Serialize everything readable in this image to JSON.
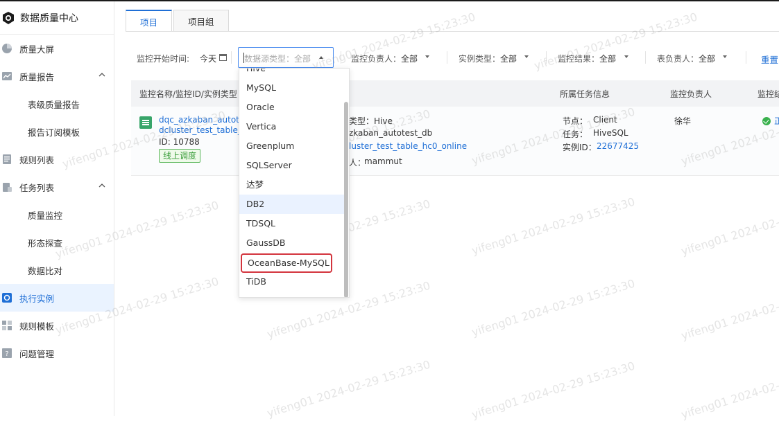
{
  "sidebar": {
    "brand": "数据质量中心",
    "items": [
      {
        "label": "质量大屏",
        "icon": "pie-chart-icon"
      },
      {
        "label": "质量报告",
        "icon": "report-icon"
      },
      {
        "label": "表级质量报告"
      },
      {
        "label": "报告订阅模板"
      },
      {
        "label": "规则列表",
        "icon": "list-icon"
      },
      {
        "label": "任务列表",
        "icon": "task-icon"
      },
      {
        "label": "质量监控"
      },
      {
        "label": "形态探查"
      },
      {
        "label": "数据比对"
      },
      {
        "label": "执行实例",
        "icon": "instance-icon",
        "active": true
      },
      {
        "label": "规则模板",
        "icon": "template-icon"
      },
      {
        "label": "问题管理",
        "icon": "question-icon"
      }
    ]
  },
  "tabs": [
    {
      "label": "项目",
      "active": true
    },
    {
      "label": "项目组",
      "active": false
    }
  ],
  "filters": {
    "start_time_label": "监控开始时间:",
    "start_time_value": "今天",
    "datasource_placeholder": "数据源类型：全部",
    "owner_label": "监控负责人：",
    "owner_value": "全部",
    "instance_type_label": "实例类型：",
    "instance_type_value": "全部",
    "result_label": "监控结果：",
    "result_value": "全部",
    "table_owner_label": "表负责人：",
    "table_owner_value": "全部",
    "reset": "重置"
  },
  "table": {
    "headers": [
      "监控名称/监控ID/实例类型",
      "",
      "所属任务信息",
      "监控负责人",
      "监控结"
    ],
    "row": {
      "name_line1": "dqc_azkaban_autotes",
      "name_line2": "dcluster_test_table_h",
      "id": "ID: 10788",
      "tag": "线上调度",
      "ds_type": "类型：Hive",
      "db": "zkaban_autotest_db",
      "table": "luster_test_table_hc0_online",
      "owner_prefix": "人：",
      "owner": "mammut",
      "node_label": "节点：",
      "node_value": "Client",
      "task_label": "任务：",
      "task_value": "HiveSQL",
      "instance_label": "实例ID：",
      "instance_value": "22677425",
      "monitor_owner": "徐华",
      "result": "正"
    }
  },
  "dropdown": {
    "items": [
      "Hive",
      "MySQL",
      "Oracle",
      "Vertica",
      "Greenplum",
      "SQLServer",
      "达梦",
      "DB2",
      "TDSQL",
      "GaussDB",
      "OceanBase-MySQL",
      "TiDB"
    ],
    "hover_item": "DB2",
    "highlighted_item": "OceanBase-MySQL"
  },
  "watermark": "yifeng01 2024-02-29 15:23:30",
  "colors": {
    "accent": "#1f6fd6",
    "highlight_box": "#d3343d",
    "success": "#39b14d"
  }
}
